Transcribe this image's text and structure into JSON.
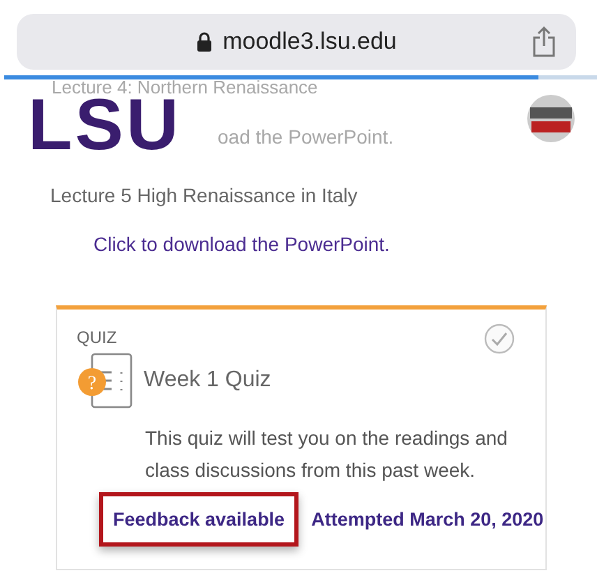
{
  "browser": {
    "address": "moodle3.lsu.edu",
    "progress": {
      "level": 0.9
    }
  },
  "header": {
    "logo": "LSU",
    "faded_texts": [
      "Lecture 4: Northern Renaissance",
      "oad the PowerPoint."
    ]
  },
  "lecture": {
    "title": "Lecture 5 High Renaissance in Italy",
    "link": "Click to download the PowerPoint."
  },
  "activity": {
    "type_label": "QUIZ",
    "completed": false,
    "icon_badge": "?",
    "title": "Week 1 Quiz",
    "description": "This quiz will test you on the readings and class discussions from this past week.",
    "links": [
      {
        "label": "Feedback available",
        "highlighted": true
      },
      {
        "label": "Attempted March 20, 2020",
        "highlighted": false
      }
    ]
  }
}
